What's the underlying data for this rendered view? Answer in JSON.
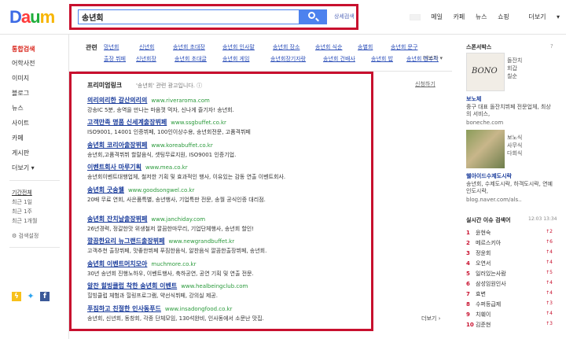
{
  "logo": {
    "parts": [
      "D",
      "a",
      "u",
      "m"
    ]
  },
  "search": {
    "query": "송년회",
    "detail_label": "상세검색"
  },
  "top_nav": [
    "메일",
    "카페",
    "뉴스",
    "쇼핑",
    "더보기"
  ],
  "left_nav": {
    "items": [
      "통합검색",
      "어학사전",
      "이미지",
      "블로그",
      "뉴스",
      "사이트",
      "카페",
      "게시판",
      "더보기"
    ],
    "period_head": "기간전체",
    "periods": [
      "최근 1일",
      "최근 1주",
      "최근 1개월"
    ],
    "detail_search": "검색설정"
  },
  "related": {
    "label": "관련",
    "row1": [
      "망년회",
      "신년회",
      "송년회 초대장",
      "송년회 인사말",
      "송년회 장소",
      "송년회 식순",
      "송별회",
      "송년회 문구"
    ],
    "row2": [
      "출장 뷔페",
      "신년회장",
      "송년회 초대글",
      "송년회 게임",
      "송년회장기자랑",
      "송년회 건배사",
      "송년회 밥",
      "송년회 현수막"
    ],
    "more": "더보기"
  },
  "premium": {
    "title": "프리미엄링크",
    "subtitle": "'송년회' 관련 광고입니다.",
    "apply": "신청하기",
    "ads": [
      {
        "title": "의리의리한 갈산의리의",
        "url": "www.riveraroma.com",
        "desc": "강송IC 5분, 송역을 만나는 마음껏 먹자, 신나게 즐기자! 송년회."
      },
      {
        "title": "고객만족 명품 신세계출장뷔페",
        "url": "www.ssgbuffet.co.kr",
        "desc": "ISO9001, 14001 인증뷔페, 100인이상수용, 송년회전문, 고품격뷔페"
      },
      {
        "title": "송년회 코리아출장뷔페",
        "url": "www.koreabuffet.co.kr",
        "desc": "송년회,고품격뷔뷔 할랄음식, 셋팅무료지원, ISO9001 인증기업."
      },
      {
        "title": "이벤트회사 마루기획",
        "url": "www.mea.co.kr",
        "desc": "송년회이벤트대행업체, 철저한 기획 및 효과적인 행사, 이유있는 감동 연출 이벤트회사."
      },
      {
        "title": "송년회 굿송웰",
        "url": "www.goodsongwel.co.kr",
        "desc": "20배 무료 연회, 사은품특별, 송년행사, 기업특판 전문, 송월 공식인증 대리점."
      },
      {
        "title": "송년회 잔치날출장뷔페",
        "url": "www.janchiday.com",
        "desc": "26년경력, 정갈한맛 위생철저 깔끔한마무리, 기업단체행사, 송년회 할인!"
      },
      {
        "title": "깔끔한요리 뉴그랜드출장뷔페",
        "url": "www.newgrandbuffet.kr",
        "desc": "고객추천 출장뷔페, 맛좋한뷔페 푸짐한음식, 알찬음식 깔끔한출장뷔페, 송년회."
      },
      {
        "title": "송년회 이벤트머치모아",
        "url": "muchmore.co.kr",
        "desc": "30년 송년회 진행노하우, 이벤트행사, 축하공연, 공연 기획 및 연출 전문."
      },
      {
        "title": "알찬 힐빙클럽 착한 송년회 이벤트",
        "url": "www.healbeingclub.com",
        "desc": "힐빙클럽 체험과 힐링프로그램, 약선식뷔페, 강의실 제공."
      },
      {
        "title": "푸짐하고 친절한 인사동푸드",
        "url": "www.insadongfood.co.kr",
        "desc": "송년회, 신년회, 동창회, 각종 단체모임, 130석완비, 인사동에서 소문난 맛집."
      }
    ],
    "more": "더보기"
  },
  "sidebar": {
    "sponsor_title": "스폰서박스",
    "sponsor_more": "?",
    "box1_caption": [
      "돌잔치",
      "회갑",
      "칠순"
    ],
    "box1_img_text": "BONO",
    "box1_title": "보노체",
    "box1_desc": "중구 대표 돌잔치뷔페 전문업체, 최상의 서비스,",
    "box1_url": "boneche.com",
    "box2_caption": [
      "보노식",
      "사무식",
      "다회식"
    ],
    "box2_title": "웰아이드수제도시락",
    "box2_desc": "송년회, 수제도시락, 하객도시락, 연예인도시락,",
    "box2_url": "blog.naver.com/als..",
    "trend_title": "실시간 이슈 검색어",
    "trend_time": "12:03 13:34",
    "trends": [
      {
        "rank": "1",
        "term": "윤현숙",
        "change": "↑2"
      },
      {
        "rank": "2",
        "term": "메르스키아",
        "change": "↑6"
      },
      {
        "rank": "3",
        "term": "정윤회",
        "change": "↑4"
      },
      {
        "rank": "4",
        "term": "오연서",
        "change": "↑4"
      },
      {
        "rank": "5",
        "term": "일러있는사람",
        "change": "↑5"
      },
      {
        "rank": "6",
        "term": "삼성임원인사",
        "change": "↑4"
      },
      {
        "rank": "7",
        "term": "효변",
        "change": "↑4"
      },
      {
        "rank": "8",
        "term": "수퍼등급제",
        "change": "↑3"
      },
      {
        "rank": "9",
        "term": "치훼이",
        "change": "↑4"
      },
      {
        "rank": "10",
        "term": "김준현",
        "change": "↑3"
      }
    ]
  },
  "colors": {
    "accent": "#4d82ee",
    "highlight_border": "#c8102e",
    "link": "#1b3d9c",
    "url": "#2a9a3b"
  }
}
